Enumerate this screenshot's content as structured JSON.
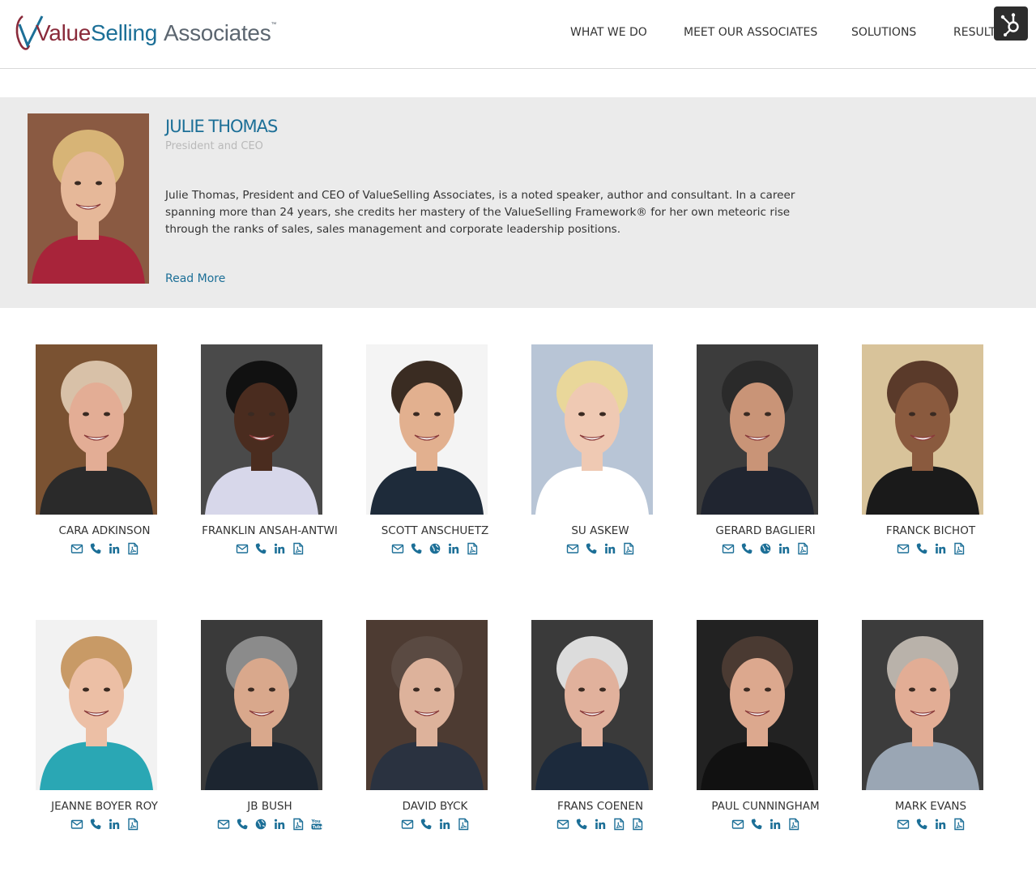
{
  "brand": {
    "logo_value": "Value",
    "logo_selling": "Selling",
    "logo_associates": "Associates",
    "logo_tm": "™",
    "accent_color": "#1c6f97",
    "maroon_color": "#8a2a3a"
  },
  "nav": {
    "items": [
      "WHAT WE DO",
      "MEET OUR ASSOCIATES",
      "SOLUTIONS",
      "RESULTS"
    ],
    "hubspot_icon": "hubspot-sprocket-icon"
  },
  "featured": {
    "name": "JULIE THOMAS",
    "title": "President and CEO",
    "bio": "Julie Thomas, President and CEO of ValueSelling Associates, is a noted speaker, author and consultant. In a career spanning more than 24 years, she credits her mastery of the ValueSelling Framework® for her own meteoric rise through the ranks of sales, sales management and corporate leadership positions.",
    "read_more": "Read More",
    "photo": {
      "bg": "#8a5a42",
      "skin": "#e6b899",
      "hair": "#d7b476",
      "shirt": "#a8243a"
    }
  },
  "associates": [
    {
      "name": "CARA ADKINSON",
      "icons": [
        "email",
        "phone",
        "linkedin",
        "pdf"
      ],
      "photo": {
        "bg": "#7a5232",
        "skin": "#e3ad95",
        "hair": "#d8c1a8",
        "shirt": "#2a2a2a"
      }
    },
    {
      "name": "FRANKLIN ANSAH-ANTWI",
      "icons": [
        "email",
        "phone",
        "linkedin",
        "pdf"
      ],
      "photo": {
        "bg": "#4a4a4a",
        "skin": "#4a2c1f",
        "hair": "#111111",
        "shirt": "#d7d7ea"
      }
    },
    {
      "name": "SCOTT ANSCHUETZ",
      "icons": [
        "email",
        "phone",
        "globe",
        "linkedin",
        "pdf"
      ],
      "photo": {
        "bg": "#f4f4f4",
        "skin": "#e2b08f",
        "hair": "#3a2c22",
        "shirt": "#1e2b3a"
      }
    },
    {
      "name": "SU ASKEW",
      "icons": [
        "email",
        "phone",
        "linkedin",
        "pdf"
      ],
      "photo": {
        "bg": "#b8c5d6",
        "skin": "#efc9b3",
        "hair": "#e9d79a",
        "shirt": "#ffffff"
      }
    },
    {
      "name": "GERARD BAGLIERI",
      "icons": [
        "email",
        "phone",
        "globe",
        "linkedin",
        "pdf"
      ],
      "photo": {
        "bg": "#3c3c3c",
        "skin": "#c99477",
        "hair": "#2a2a2a",
        "shirt": "#202530"
      }
    },
    {
      "name": "FRANCK BICHOT",
      "icons": [
        "email",
        "phone",
        "linkedin",
        "pdf"
      ],
      "photo": {
        "bg": "#d8c39a",
        "skin": "#8a5a3e",
        "hair": "#5a3a2a",
        "shirt": "#1a1a1a"
      }
    },
    {
      "name": "JEANNE BOYER ROY",
      "icons": [
        "email",
        "phone",
        "linkedin",
        "pdf"
      ],
      "photo": {
        "bg": "#f2f2f2",
        "skin": "#ecbfa5",
        "hair": "#c89a66",
        "shirt": "#2aa7b4"
      }
    },
    {
      "name": "JB BUSH",
      "icons": [
        "email",
        "phone",
        "globe",
        "linkedin",
        "pdf",
        "youtube"
      ],
      "photo": {
        "bg": "#3a3a3a",
        "skin": "#d9a88c",
        "hair": "#8b8b8b",
        "shirt": "#1c2530"
      }
    },
    {
      "name": "DAVID BYCK",
      "icons": [
        "email",
        "phone",
        "linkedin",
        "pdf"
      ],
      "photo": {
        "bg": "#4d3b32",
        "skin": "#ddb29b",
        "hair": "#5a4a42",
        "shirt": "#2a3240"
      }
    },
    {
      "name": "FRANS COENEN",
      "icons": [
        "email",
        "phone",
        "linkedin",
        "pdf",
        "pdf"
      ],
      "photo": {
        "bg": "#3a3a3a",
        "skin": "#e1b19c",
        "hair": "#dcdcdc",
        "shirt": "#1c2a3c"
      }
    },
    {
      "name": "PAUL CUNNINGHAM",
      "icons": [
        "email",
        "phone",
        "linkedin",
        "pdf"
      ],
      "photo": {
        "bg": "#222222",
        "skin": "#dca88e",
        "hair": "#4a3a32",
        "shirt": "#111111"
      }
    },
    {
      "name": "MARK EVANS",
      "icons": [
        "email",
        "phone",
        "linkedin",
        "pdf"
      ],
      "photo": {
        "bg": "#3c3c3c",
        "skin": "#e2ad95",
        "hair": "#b9b2aa",
        "shirt": "#9aa6b4"
      }
    }
  ]
}
